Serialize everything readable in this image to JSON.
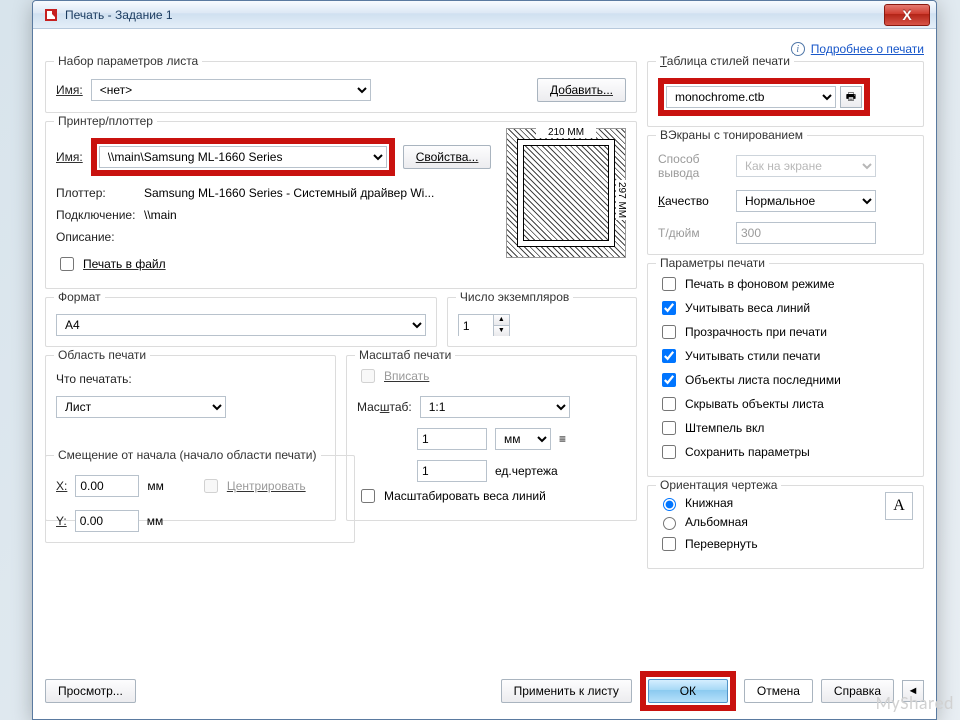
{
  "window": {
    "title": "Печать - Задание 1"
  },
  "top": {
    "more_link": "Подробнее о печати"
  },
  "pageset": {
    "title": "Набор параметров листа",
    "name_label": "Имя:",
    "name_value": "<нет>",
    "add_label": "Добавить..."
  },
  "printer": {
    "title": "Принтер/плоттер",
    "name_label": "Имя:",
    "name_value": "\\\\main\\Samsung ML-1660 Series",
    "props_label": "Свойства...",
    "plotter_label": "Плоттер:",
    "plotter_value": "Samsung ML-1660 Series - Системный драйвер Wi...",
    "where_label": "Подключение:",
    "where_value": "\\\\main",
    "desc_label": "Описание:",
    "desc_value": "",
    "to_file_label": "Печать в файл",
    "paper_w": "210 MM",
    "paper_h": "297 MM"
  },
  "format": {
    "title": "Формат",
    "value": "A4"
  },
  "copies": {
    "title": "Число экземпляров",
    "value": "1"
  },
  "area": {
    "title": "Область печати",
    "what_label": "Что печатать:",
    "what_value": "Лист"
  },
  "scale": {
    "title": "Масштаб печати",
    "fit_label": "Вписать",
    "scale_label": "Масштаб:",
    "scale_value": "1:1",
    "num": "1",
    "unit_value": "мм",
    "den": "1",
    "den_unit": "ед.чертежа",
    "lw_label": "Масштабировать веса линий"
  },
  "offset": {
    "title": "Смещение от начала (начало области печати)",
    "x_label": "X:",
    "x_value": "0.00",
    "x_unit": "мм",
    "y_label": "Y:",
    "y_value": "0.00",
    "y_unit": "мм",
    "center_label": "Центрировать"
  },
  "styletable": {
    "title": "Таблица стилей печати",
    "value": "monochrome.ctb"
  },
  "shaded": {
    "title": "ВЭкраны с тонированием",
    "mode_label": "Способ вывода",
    "mode_value": "Как на экране",
    "quality_label": "Качество",
    "quality_value": "Нормальное",
    "dpi_label": "Т/дюйм",
    "dpi_value": "300"
  },
  "options": {
    "title": "Параметры печати",
    "bg": "Печать в фоновом режиме",
    "lw": "Учитывать веса линий",
    "transp": "Прозрачность при печати",
    "styles": "Учитывать стили печати",
    "paperspace": "Объекты листа последними",
    "hide": "Скрывать объекты листа",
    "stamp": "Штемпель вкл",
    "save": "Сохранить параметры"
  },
  "orient": {
    "title": "Ориентация чертежа",
    "portrait": "Книжная",
    "landscape": "Альбомная",
    "upside": "Перевернуть"
  },
  "footer": {
    "preview": "Просмотр...",
    "apply": "Применить к листу",
    "ok": "ОК",
    "cancel": "Отмена",
    "help": "Справка"
  }
}
